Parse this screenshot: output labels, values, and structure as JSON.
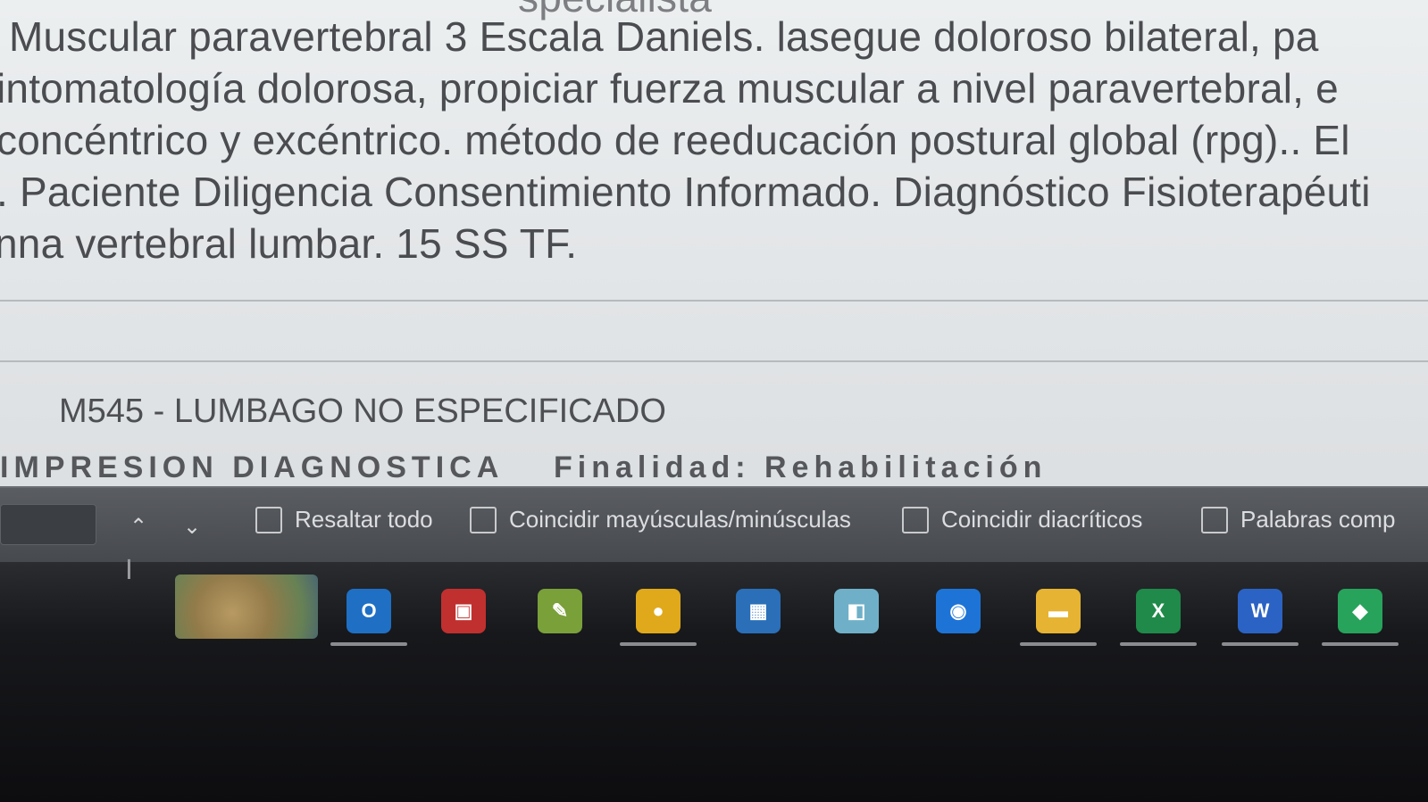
{
  "document": {
    "lines": [
      "specialista",
      "Muscular paravertebral 3 Escala Daniels. lasegue doloroso bilateral, pa",
      "intomatología dolorosa, propiciar fuerza muscular a nivel paravertebral, e",
      "concéntrico y excéntrico. método de reeducación postural global (rpg).. El",
      ". Paciente Diligencia Consentimiento Informado. Diagnóstico Fisioterapéuti",
      "nna vertebral lumbar. 15 SS TF."
    ],
    "diagnosis": "M545 - LUMBAGO NO ESPECIFICADO",
    "cut_label_1": "IMPRESION DIAGNOSTICA",
    "cut_label_2": "Finalidad: Rehabilitación"
  },
  "find_bar": {
    "search_value": "",
    "options": [
      {
        "label": "Resaltar todo",
        "checked": false
      },
      {
        "label": "Coincidir mayúsculas/minúsculas",
        "checked": false
      },
      {
        "label": "Coincidir diacríticos",
        "checked": false
      },
      {
        "label": "Palabras comp",
        "checked": false
      }
    ],
    "prev_icon": "chevron-up-icon",
    "next_icon": "chevron-down-icon"
  },
  "taskbar": {
    "apps": [
      {
        "name": "outlook-icon",
        "glyph": "O",
        "color": "#1f6fc4"
      },
      {
        "name": "snipping-tool-icon",
        "glyph": "▣",
        "color": "#c0302e"
      },
      {
        "name": "image-editor-icon",
        "glyph": "✎",
        "color": "#7aa03a"
      },
      {
        "name": "chrome-icon",
        "glyph": "●",
        "color": "#e0a91c"
      },
      {
        "name": "calculator-icon",
        "glyph": "▦",
        "color": "#2a6fb8"
      },
      {
        "name": "notes-icon",
        "glyph": "◧",
        "color": "#6fb0c8"
      },
      {
        "name": "browser-icon",
        "glyph": "◉",
        "color": "#1d74d6"
      },
      {
        "name": "file-explorer-icon",
        "glyph": "▬",
        "color": "#e6b432"
      },
      {
        "name": "excel-icon",
        "glyph": "X",
        "color": "#1f8a4a"
      },
      {
        "name": "word-icon",
        "glyph": "W",
        "color": "#2b63c4"
      },
      {
        "name": "security-icon",
        "glyph": "◆",
        "color": "#27a35c"
      }
    ]
  }
}
